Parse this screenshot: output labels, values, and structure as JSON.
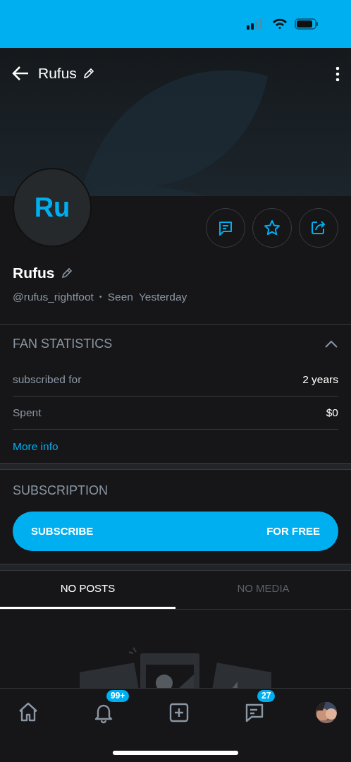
{
  "header": {
    "title": "Rufus"
  },
  "profile": {
    "initials": "Ru",
    "name": "Rufus",
    "handle": "@rufus_rightfoot",
    "separator": "•",
    "seen_label": "Seen",
    "seen_value": "Yesterday"
  },
  "fan_statistics": {
    "title": "FAN STATISTICS",
    "expanded": true,
    "rows": [
      {
        "label": "subscribed for",
        "value": "2 years"
      },
      {
        "label": "Spent",
        "value": "$0"
      }
    ],
    "link": "More info"
  },
  "subscription": {
    "title": "SUBSCRIPTION",
    "button_label": "SUBSCRIBE",
    "button_price": "FOR FREE"
  },
  "tabs": [
    {
      "label": "NO POSTS",
      "selected": true
    },
    {
      "label": "NO MEDIA",
      "selected": false
    }
  ],
  "bottom_nav": [
    {
      "kind": "home"
    },
    {
      "kind": "notifications",
      "badge": "99+"
    },
    {
      "kind": "add"
    },
    {
      "kind": "messages",
      "badge": "27"
    },
    {
      "kind": "avatar"
    }
  ]
}
